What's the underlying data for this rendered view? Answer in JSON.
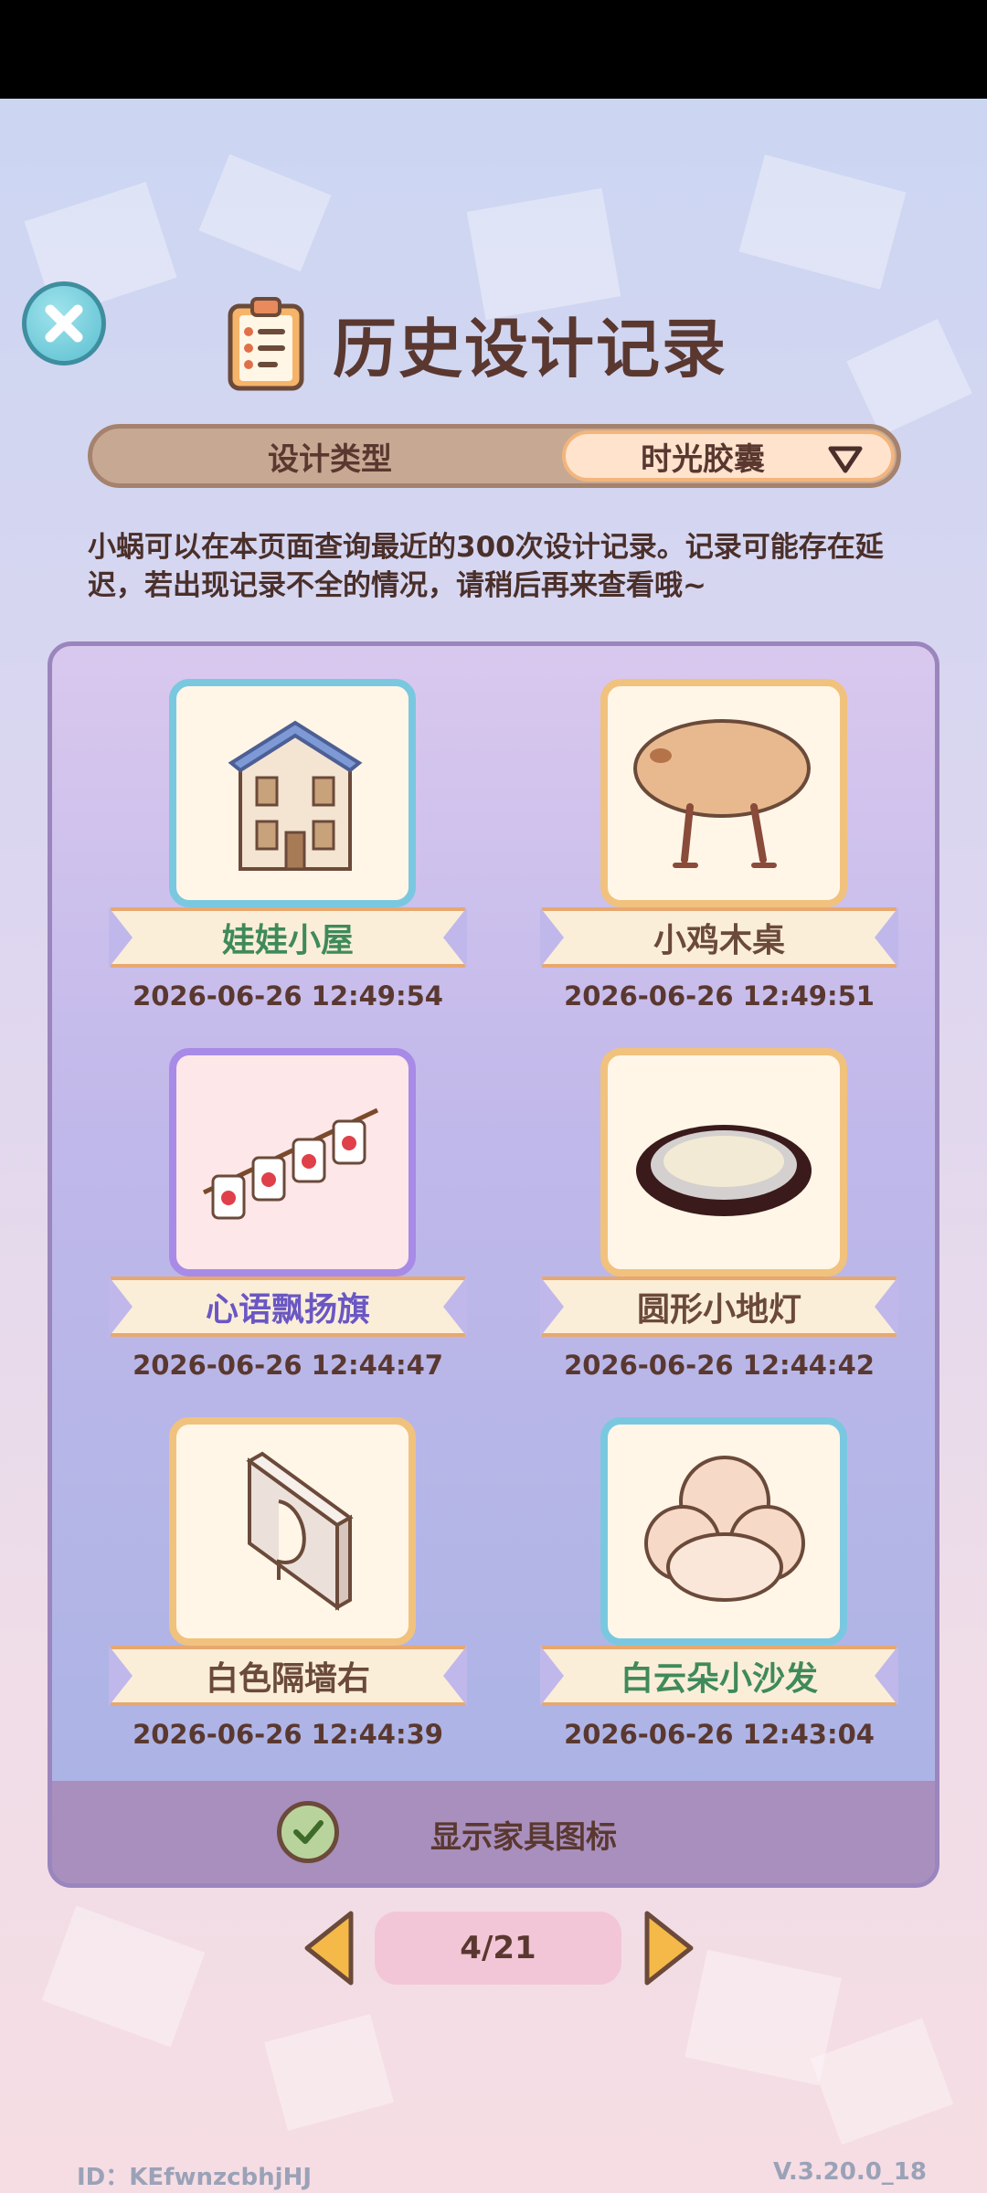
{
  "header": {
    "title": "历史设计记录",
    "close_icon": "close-icon",
    "title_icon": "clipboard-icon"
  },
  "tabs": {
    "left_label": "设计类型",
    "right_label": "时光胶囊",
    "right_icon": "dropdown-triangle-icon"
  },
  "notice": "小蜗可以在本页面查询最近的300次设计记录。记录可能存在延迟，若出现记录不全的情况，请稍后再来查看哦~",
  "records": [
    {
      "name": "娃娃小屋",
      "time": "2026-06-26 12:49:54",
      "name_color": "#3f8a5a",
      "frame": "blue",
      "icon": "dollhouse-icon"
    },
    {
      "name": "小鸡木桌",
      "time": "2026-06-26 12:49:51",
      "name_color": "#6b4a3a",
      "frame": "orange",
      "icon": "chick-table-icon"
    },
    {
      "name": "心语飘扬旗",
      "time": "2026-06-26 12:44:47",
      "name_color": "#6a57c4",
      "frame": "purple",
      "icon": "heart-flag-icon"
    },
    {
      "name": "圆形小地灯",
      "time": "2026-06-26 12:44:42",
      "name_color": "#6b4a3a",
      "frame": "orange",
      "icon": "round-floor-lamp-icon"
    },
    {
      "name": "白色隔墙右",
      "time": "2026-06-26 12:44:39",
      "name_color": "#6b4a3a",
      "frame": "orange",
      "icon": "white-wall-icon"
    },
    {
      "name": "白云朵小沙发",
      "time": "2026-06-26 12:43:04",
      "name_color": "#3f8a5a",
      "frame": "blue",
      "icon": "cloud-sofa-icon"
    }
  ],
  "footer": {
    "show_icon_label": "显示家具图标",
    "checked": true
  },
  "pager": {
    "text": "4/21",
    "current": 4,
    "total": 21
  },
  "meta": {
    "id_text": "ID：KEfwnzcbhjHJ",
    "version_text": "V.3.20.0_18"
  }
}
